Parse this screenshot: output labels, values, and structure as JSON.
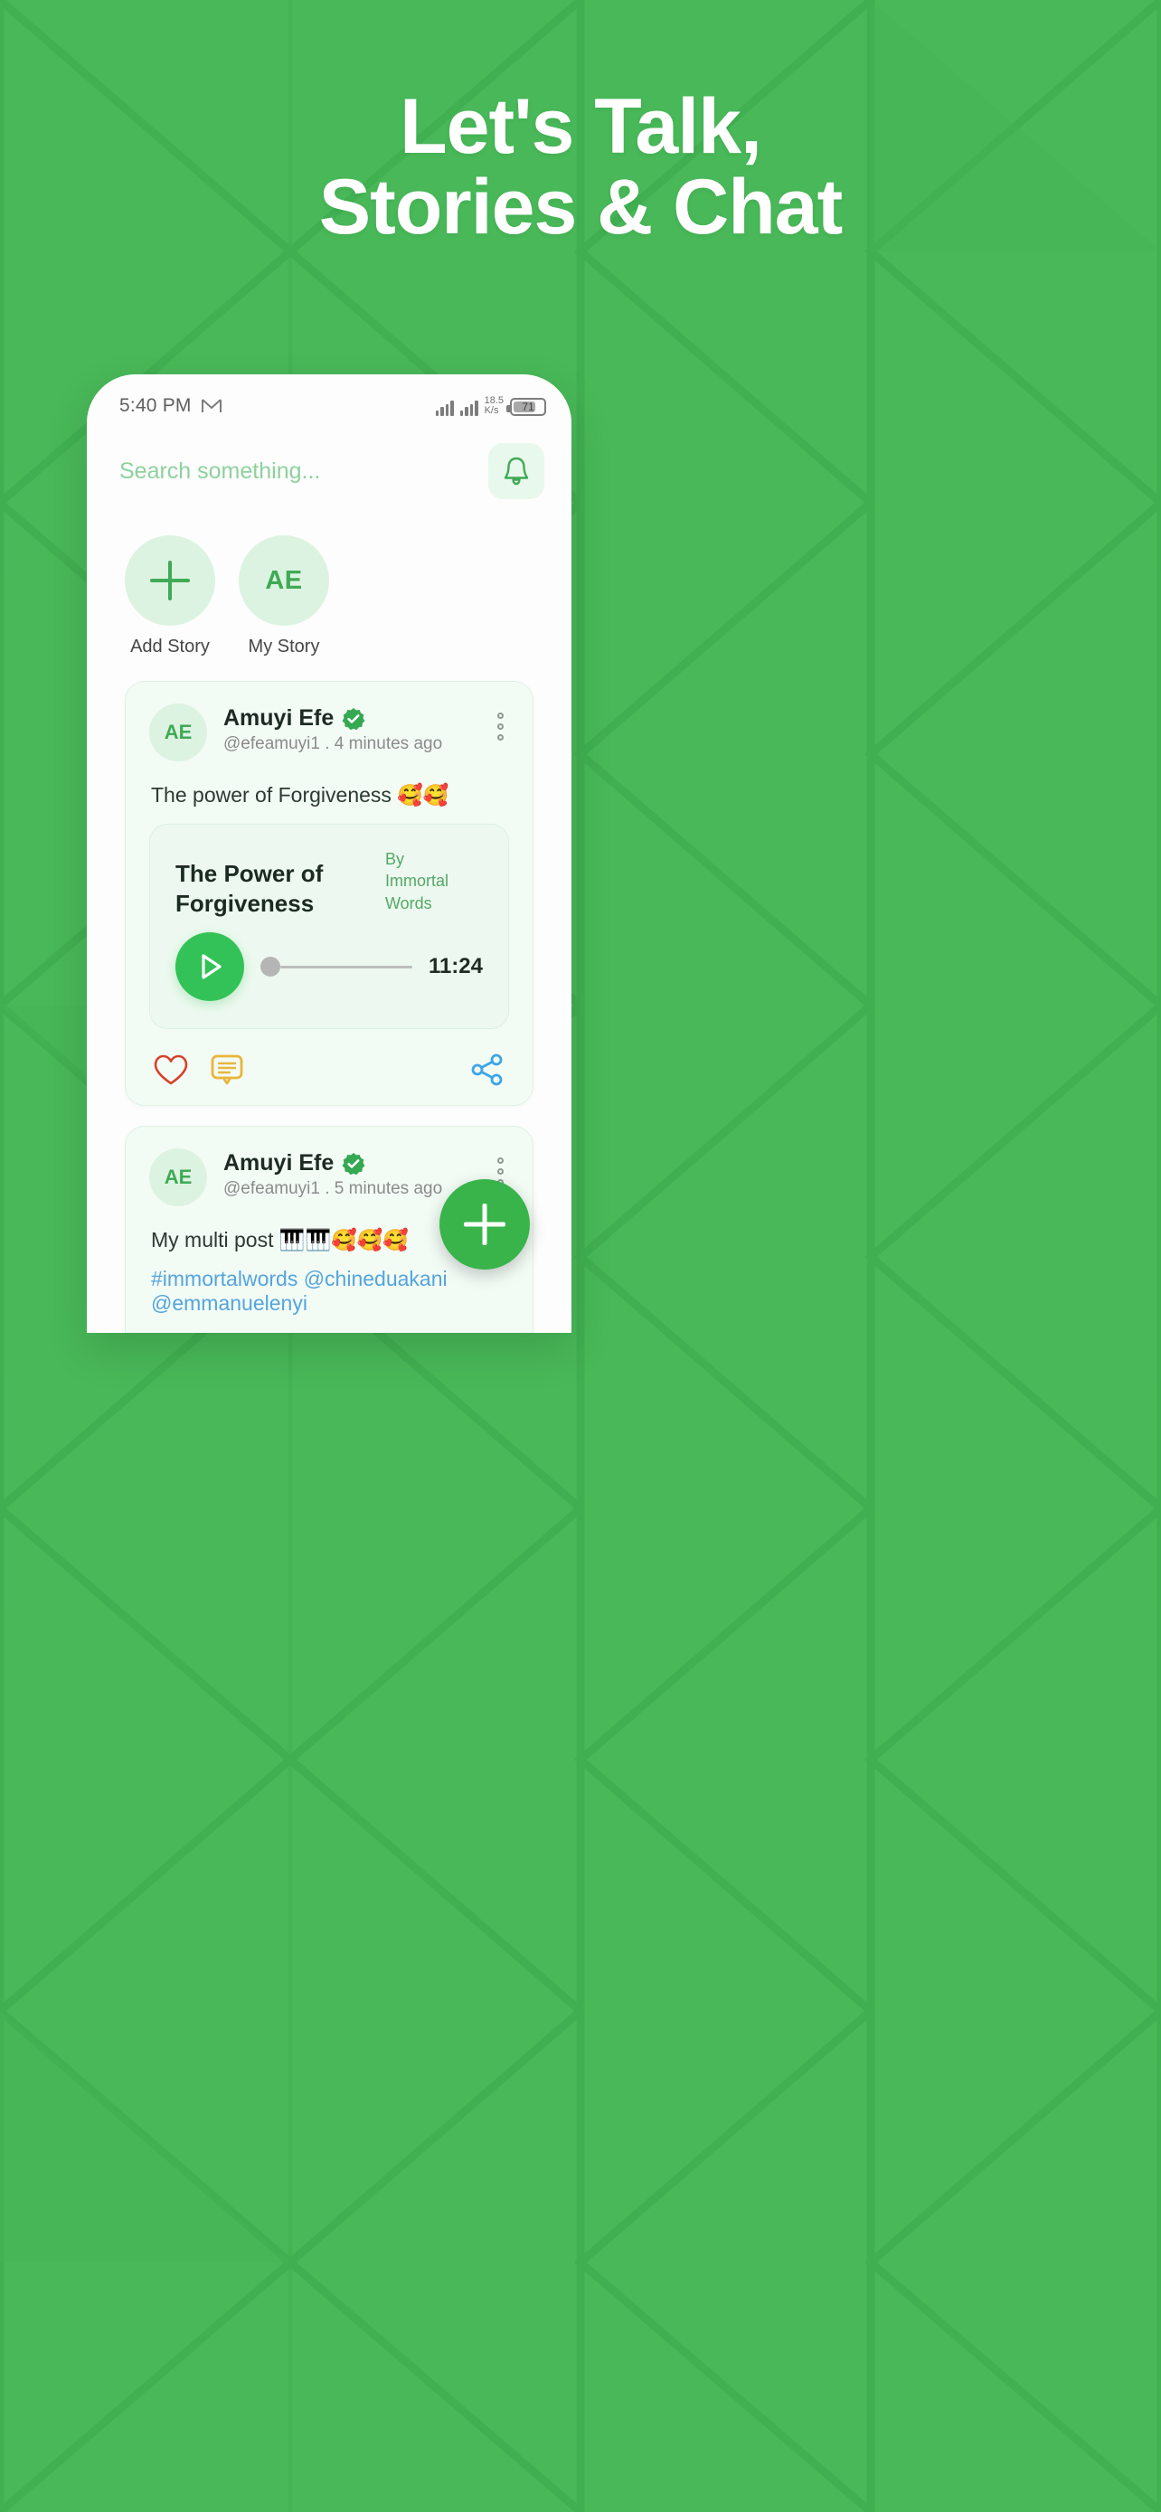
{
  "theme": {
    "brand_green": "#48b858",
    "accent_green": "#32c257",
    "fab_green": "#38b44a",
    "card_bg": "#f3fbf5",
    "link_blue": "#53a5dd",
    "heart_red": "#d6412b",
    "comment_yellow": "#e9b63a",
    "share_blue": "#3da5e8"
  },
  "promo": {
    "headline_line1": "Let's Talk,",
    "headline_line2": "Stories & Chat"
  },
  "status_bar": {
    "time": "5:40 PM",
    "notification_icon": "gmail-icon",
    "network_speed_value": "18.5",
    "network_speed_unit": "K/s",
    "battery_percent": "71"
  },
  "search": {
    "placeholder": "Search something...",
    "value": "",
    "bell_icon": "bell-icon"
  },
  "stories": [
    {
      "avatar": "+",
      "label": "Add Story",
      "type": "add"
    },
    {
      "avatar": "AE",
      "label": "My Story",
      "type": "user"
    }
  ],
  "feed": [
    {
      "avatar": "AE",
      "name": "Amuyi Efe",
      "verified": true,
      "meta": "@efeamuyi1 . 4 minutes ago",
      "text": "The power of Forgiveness 🥰🥰",
      "audio": {
        "title": "The Power of Forgiveness",
        "by_label": "By",
        "by_line1": "Immortal",
        "by_line2": "Words",
        "duration": "11:24",
        "progress_percent": 0,
        "play_icon": "play-icon"
      },
      "actions": {
        "like_icon": "heart-icon",
        "comment_icon": "comment-icon",
        "share_icon": "share-icon"
      }
    },
    {
      "avatar": "AE",
      "name": "Amuyi Efe",
      "verified": true,
      "meta": "@efeamuyi1 . 5 minutes ago",
      "text": "My multi post 🎹🎹🥰🥰🥰",
      "tags": "#immortalwords @chineduakani @emmanuelenyi",
      "media_alt": "white-window-photo"
    }
  ],
  "fab": {
    "icon": "plus-icon",
    "label": "+"
  }
}
